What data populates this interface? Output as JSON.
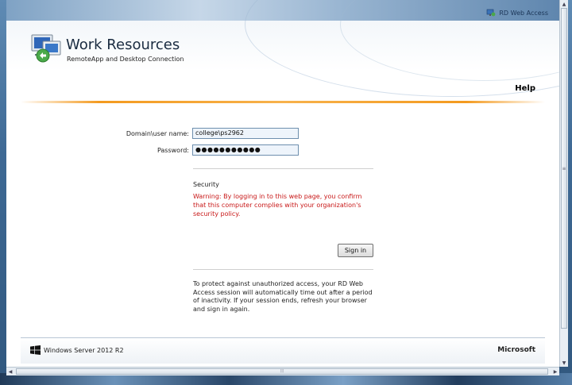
{
  "header": {
    "rdwa_label": "RD Web Access",
    "title": "Work Resources",
    "subtitle": "RemoteApp and Desktop Connection",
    "help": "Help"
  },
  "form": {
    "username_label": "Domain\\user name:",
    "username_value": "college\\ps2962",
    "password_label": "Password:",
    "password_value": "●●●●●●●●●●●"
  },
  "security": {
    "title": "Security",
    "warning": "Warning: By logging in to this web page, you confirm that this computer complies with your organization's security policy."
  },
  "signin_label": "Sign in",
  "info": "To protect against unauthorized access, your RD Web Access session will automatically time out after a period of inactivity. If your session ends, refresh your browser and sign in again.",
  "footer": {
    "windows_server": "Windows Server 2012 R2",
    "microsoft": "Microsoft"
  },
  "scrollbars": {
    "grip": "≡",
    "hgrip": "⦙⦙⦙"
  },
  "colors": {
    "accent_orange": "#f39a1f",
    "warning_red": "#c81818"
  }
}
